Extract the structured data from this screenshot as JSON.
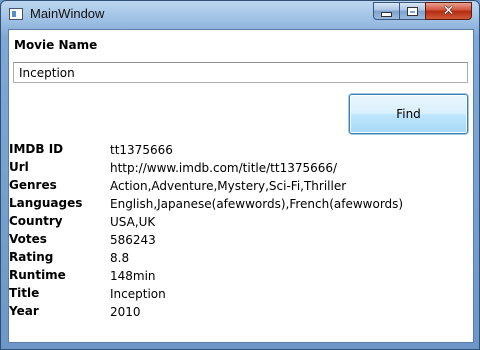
{
  "window": {
    "title": "MainWindow"
  },
  "form": {
    "movie_label": "Movie Name",
    "movie_value": "Inception",
    "find_label": "Find"
  },
  "details": [
    {
      "key": "IMDB ID",
      "value": "tt1375666"
    },
    {
      "key": "Url",
      "value": "http://www.imdb.com/title/tt1375666/"
    },
    {
      "key": "Genres",
      "value": "Action,Adventure,Mystery,Sci-Fi,Thriller"
    },
    {
      "key": "Languages",
      "value": "English,Japanese(afewwords),French(afewwords)"
    },
    {
      "key": "Country",
      "value": "USA,UK"
    },
    {
      "key": "Votes",
      "value": "586243"
    },
    {
      "key": "Rating",
      "value": "8.8"
    },
    {
      "key": "Runtime",
      "value": "148min"
    },
    {
      "key": "Title",
      "value": "Inception"
    },
    {
      "key": "Year",
      "value": "2010"
    }
  ]
}
